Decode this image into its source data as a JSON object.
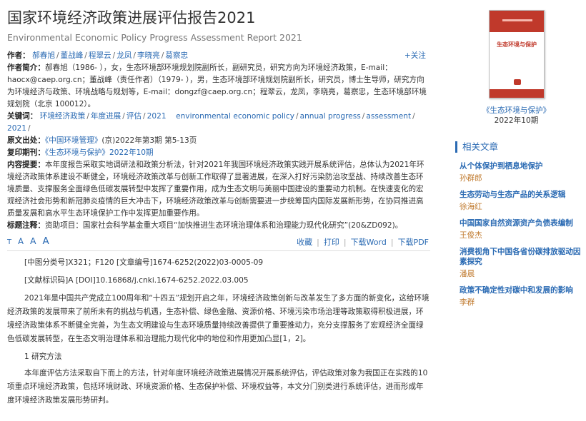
{
  "title_cn": "国家环境经济政策进展评估报告2021",
  "title_en": "Environmental Economic Policy Progress Assessment Report 2021",
  "authors": {
    "label": "作者：",
    "names": [
      "郝春旭",
      "董战峰",
      "程翠云",
      "龙凤",
      "李晓亮",
      "葛察忠"
    ],
    "follow": "+关注"
  },
  "author_intro": {
    "label": "作者简介：",
    "text": "郝春旭（1986- ），女，生态环境部环境规划院副所长，副研究员，研究方向为环境经济政策，E-mail：haocx@caep.org.cn；董战峰（责任作者）（1979- ），男，生态环境部环境规划院副所长，研究员，博士生导师，研究方向为环境经济与政策、环境战略与规划等，E-mail：dongzf@caep.org.cn；程翠云，龙凤，李晓亮，葛察忠，生态环境部环境规划院（北京 100012）。"
  },
  "keywords": {
    "label": "关键词：",
    "items": [
      "环境经济政策",
      "年度进展",
      "评估",
      "2021",
      "environmental economic policy",
      "annual progress",
      "assessment",
      "2021"
    ]
  },
  "source": {
    "label": "原文出处：",
    "journal": "《中国环境管理》",
    "rest": "(京)2022年第3期 第5-13页"
  },
  "reprint": {
    "label": "复印期刊：",
    "value": "《生态环境与保护》2022年10期"
  },
  "abstract": {
    "label": "内容提要：",
    "text": "本年度报告采取实地调研法和政策分析法，针对2021年我国环境经济政策实践开展系统评估，总体认为2021年环境经济政策体系建设不断健全，环境经济政策改革与创新工作取得了显著进展，在深入打好污染防治攻坚战、持续改善生态环境质量、支撑服务全面绿色低碳发展转型中发挥了重要作用，成为生态文明与美丽中国建设的重要动力机制。在快速变化的宏观经济社会形势和新冠肺炎疫情的巨大冲击下，环境经济政策改革与创新需要进一步统筹国内国际发展新形势，在协同推进高质量发展和高水平生态环境保护工作中发挥更加重要作用。"
  },
  "funding": {
    "label": "标题注释：",
    "text": "资助项目：国家社会科学基金重大项目“加快推进生态环境治理体系和治理能力现代化研究”(20&ZD092)。"
  },
  "toolbar": {
    "font_t": "T",
    "font_a": "A",
    "collect": "收藏",
    "print": "打印",
    "download_word": "下载Word",
    "download_pdf": "下载PDF"
  },
  "body": {
    "classification": "[中图分类号]X321；F120 [文章编号]1674-6252(2022)03-0005-09",
    "doc_id": "[文献标识码]A [DOI]10.16868/j.cnki.1674-6252.2022.03.005",
    "para1": "2021年是中国共产党成立100周年和“十四五”规划开启之年，环境经济政策创新与改革发生了多方面的新变化，这给环境经济政策的发展带来了前所未有的挑战与机遇，生态补偿、绿色金融、资源价格、环境污染市场治理等政策取得积极进展，环境经济政策体系不断健全完善，为生态文明建设与生态环境质量持续改善提供了重要推动力，充分支撑服务了宏观经济全面绿色低碳发展转型，在生态文明治理体系和治理能力现代化中的地位和作用更加凸显[1，2]。",
    "section1": "1 研究方法",
    "para2": "本年度评估方法采取自下而上的方法，针对年度环境经济政策进展情况开展系统评估，评估政策对象为我国正在实践的10项重点环境经济政策，包括环境财政、环境资源价格、生态保护补偿、环境权益等，本文分门别类进行系统评估，进而形成年度环境经济政策发展形势研判。"
  },
  "cover": {
    "title": "生态环境与保护"
  },
  "journal_side": {
    "name": "《生态环境与保护》",
    "issue": "2022年10期"
  },
  "related": {
    "heading": "相关文章",
    "items": [
      {
        "title": "从个体保护到栖息地保护",
        "author": "孙群郎"
      },
      {
        "title": "生态劳动与生态产品的关系逻辑",
        "author": "徐海红"
      },
      {
        "title": "中国国家自然资源资产负债表编制",
        "author": "王俊杰"
      },
      {
        "title": "消费视角下中国各省份碳排放驱动因素探究",
        "author": "潘晨"
      },
      {
        "title": "政策不确定性对碳中和发展的影响",
        "author": "李群"
      }
    ]
  },
  "colors": {
    "link": "#2a6ab3",
    "related_author": "#c07a2e",
    "cover_red": "#c0392b"
  }
}
